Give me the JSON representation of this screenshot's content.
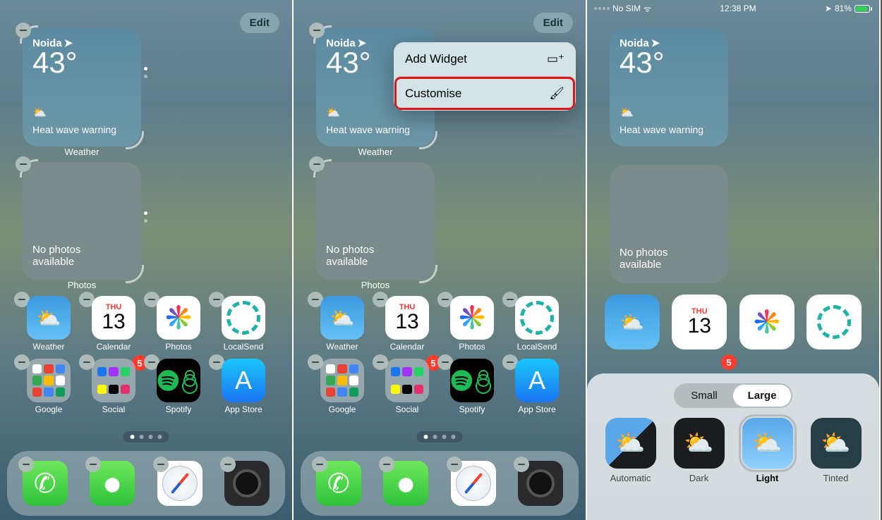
{
  "edit_label": "Edit",
  "widgets": {
    "weather": {
      "label": "Weather",
      "location": "Noida",
      "temp": "43°",
      "condition": "⛅",
      "warning": "Heat wave warning"
    },
    "photos": {
      "label": "Photos",
      "empty_text": "No photos available"
    }
  },
  "apps": {
    "weather": "Weather",
    "calendar": {
      "label": "Calendar",
      "day": "THU",
      "date": "13"
    },
    "photos": "Photos",
    "localsend": "LocalSend",
    "google": "Google",
    "social": {
      "label": "Social",
      "badge": "5"
    },
    "spotify": "Spotify",
    "appstore": "App Store"
  },
  "edit_menu": {
    "add_widget": "Add Widget",
    "customise": "Customise"
  },
  "status": {
    "carrier": "No SIM",
    "time": "12:38 PM",
    "battery_pct": "81%"
  },
  "customise_sheet": {
    "size_small": "Small",
    "size_large": "Large",
    "themes": {
      "automatic": "Automatic",
      "dark": "Dark",
      "light": "Light",
      "tinted": "Tinted"
    }
  }
}
